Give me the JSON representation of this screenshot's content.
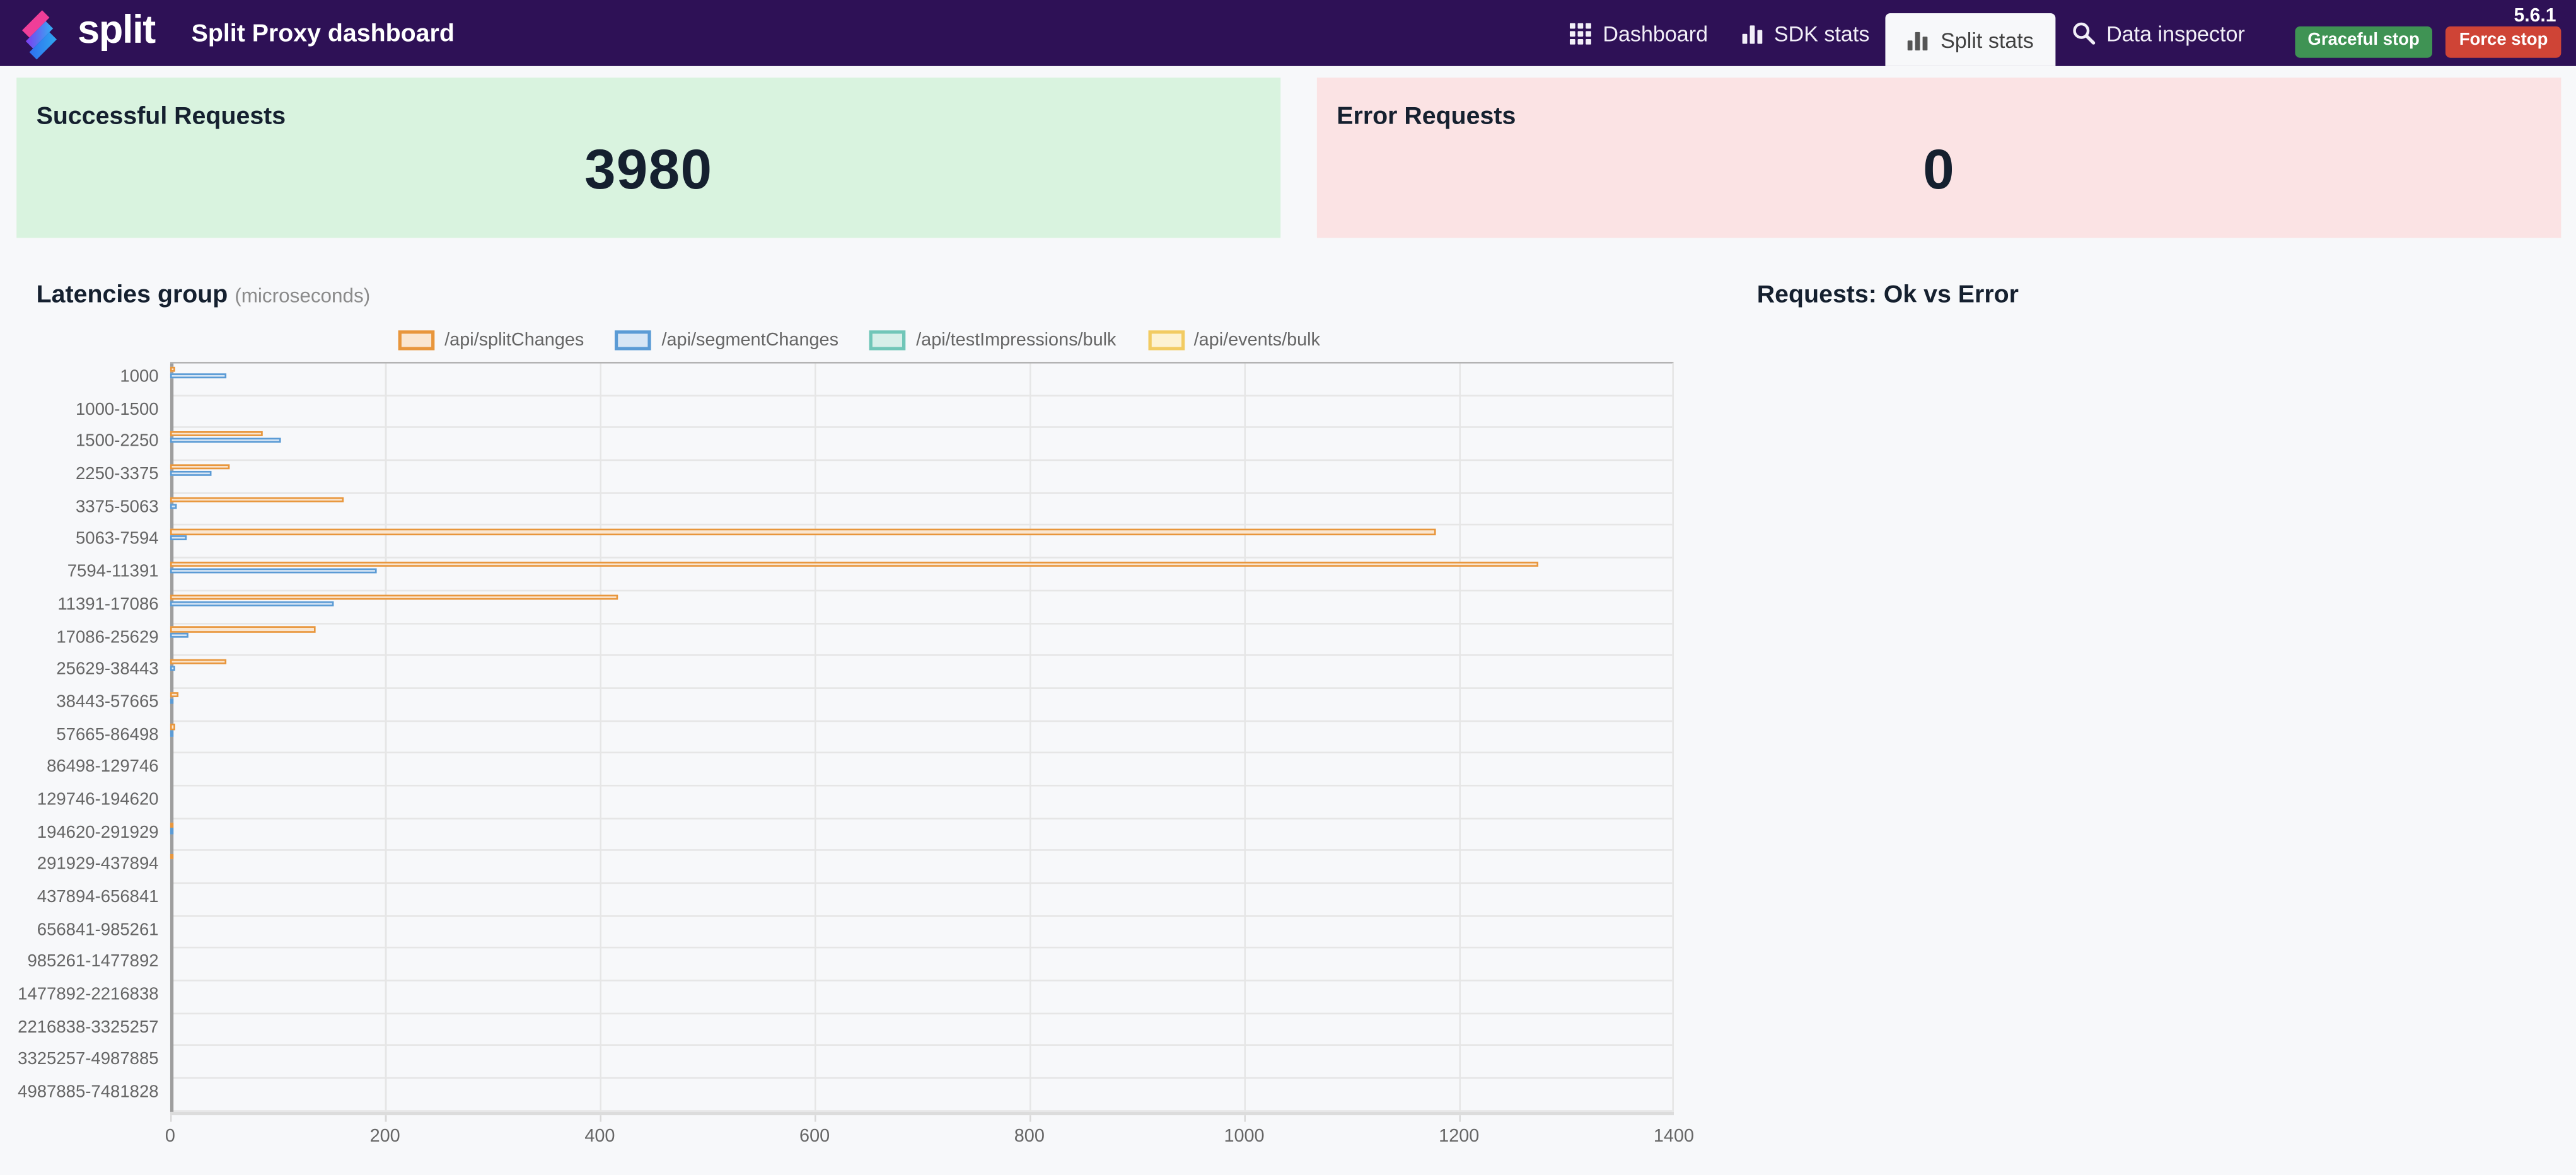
{
  "navbar": {
    "brand": "split",
    "title": "Split Proxy dashboard",
    "version": "5.6.1",
    "items": [
      {
        "id": "dashboard",
        "label": "Dashboard",
        "icon": "grid-icon",
        "active": false
      },
      {
        "id": "sdk-stats",
        "label": "SDK stats",
        "icon": "bar-chart-icon",
        "active": false
      },
      {
        "id": "split-stats",
        "label": "Split stats",
        "icon": "bar-chart-icon",
        "active": true
      },
      {
        "id": "data-inspector",
        "label": "Data inspector",
        "icon": "search-icon",
        "active": false
      }
    ],
    "buttons": [
      {
        "id": "graceful-stop",
        "label": "Graceful stop",
        "color": "#3f9354"
      },
      {
        "id": "force-stop",
        "label": "Force stop",
        "color": "#cf4436"
      }
    ]
  },
  "cards": {
    "success": {
      "title": "Successful Requests",
      "value": "3980",
      "bg": "#d9f3df"
    },
    "error": {
      "title": "Error Requests",
      "value": "0",
      "bg": "#fbe3e4"
    }
  },
  "chart_data": [
    {
      "type": "bar",
      "orientation": "horizontal",
      "title": "Latencies group",
      "subtitle": "(microseconds)",
      "legend_position": "top",
      "grid": true,
      "xlim": [
        0,
        1400
      ],
      "xticks": [
        0,
        200,
        400,
        600,
        800,
        1000,
        1200,
        1400
      ],
      "categories": [
        "1000",
        "1000-1500",
        "1500-2250",
        "2250-3375",
        "3375-5063",
        "5063-7594",
        "7594-11391",
        "11391-17086",
        "17086-25629",
        "25629-38443",
        "38443-57665",
        "57665-86498",
        "86498-129746",
        "129746-194620",
        "194620-291929",
        "291929-437894",
        "437894-656841",
        "656841-985261",
        "985261-1477892",
        "1477892-2216838",
        "2216838-3325257",
        "3325257-4987885",
        "4987885-7481828"
      ],
      "series": [
        {
          "name": "/api/splitChanges",
          "border": "#e8963c",
          "fill": "#fae6d0",
          "values": [
            4,
            0,
            86,
            55,
            162,
            1180,
            1275,
            417,
            135,
            53,
            7,
            4,
            0,
            0,
            2,
            2,
            0,
            0,
            0,
            0,
            0,
            0,
            0
          ]
        },
        {
          "name": "/api/segmentChanges",
          "border": "#5b9bd5",
          "fill": "#d7e6f5",
          "values": [
            52,
            0,
            103,
            39,
            6,
            16,
            193,
            153,
            17,
            5,
            1,
            1,
            0,
            0,
            2,
            0,
            0,
            0,
            0,
            0,
            0,
            0,
            0
          ]
        },
        {
          "name": "/api/testImpressions/bulk",
          "border": "#70c6b8",
          "fill": "#d6efe9",
          "values": [
            0,
            0,
            0,
            0,
            0,
            0,
            0,
            0,
            0,
            0,
            0,
            0,
            0,
            0,
            0,
            0,
            0,
            0,
            0,
            0,
            0,
            0,
            0
          ]
        },
        {
          "name": "/api/events/bulk",
          "border": "#f2cb62",
          "fill": "#fdf2d2",
          "values": [
            0,
            0,
            0,
            0,
            0,
            0,
            0,
            0,
            0,
            0,
            0,
            0,
            0,
            0,
            0,
            0,
            0,
            0,
            0,
            0,
            0,
            0,
            0
          ]
        }
      ]
    },
    {
      "type": "pie",
      "title": "Requests: Ok vs Error"
    }
  ]
}
